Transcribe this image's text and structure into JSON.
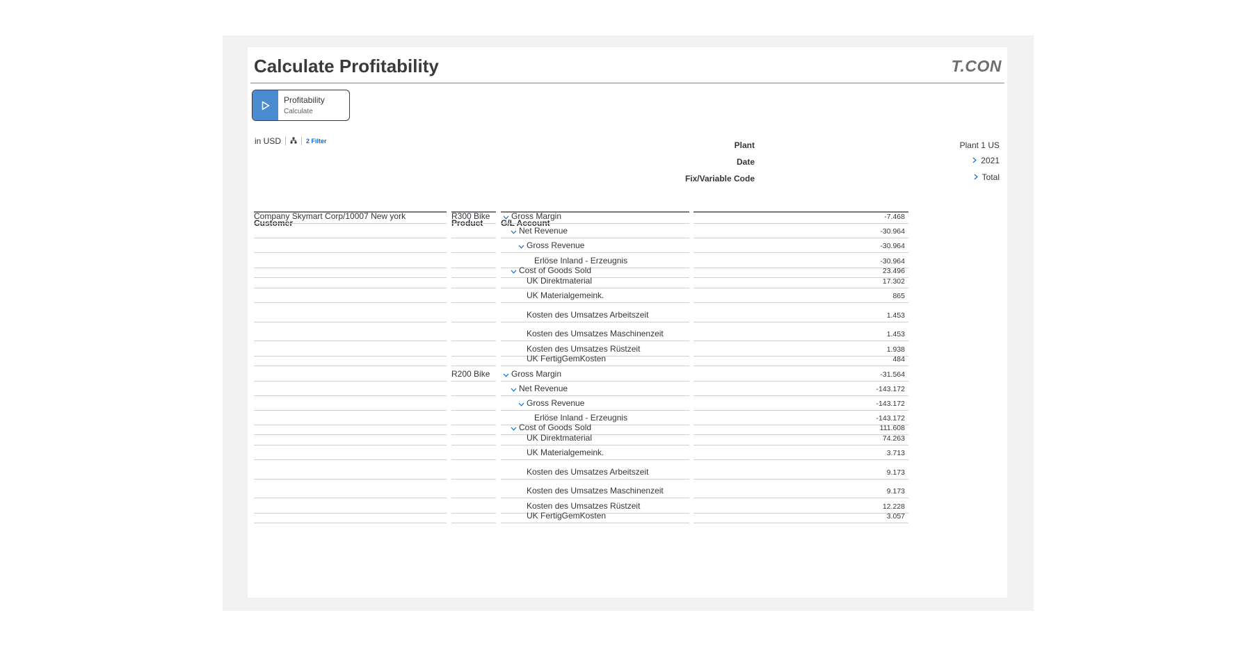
{
  "header": {
    "title": "Calculate Profitability",
    "logo_text": "T.CON"
  },
  "tile": {
    "title": "Profitability",
    "subtitle": "Calculate",
    "icon": "play-icon",
    "icon_bg": "#4a8ccf"
  },
  "subheader": {
    "currency": "in USD",
    "filter_icon": "hierarchy-icon",
    "filter_label": "2 Filter"
  },
  "dimensions": {
    "plant": {
      "label": "Plant",
      "value": "Plant 1 US"
    },
    "date": {
      "label": "Date",
      "value": "2021"
    },
    "fixvar": {
      "label": "Fix/Variable Code",
      "value": "Total"
    }
  },
  "columns": {
    "customer": "Customer",
    "product": "Product",
    "account": "G/L Account"
  },
  "rows": [
    {
      "customer": "Company Skymart Corp/10007 New york",
      "product": "R300 Bike",
      "account": "Gross Margin",
      "level": 0,
      "expanded": true,
      "value": "-7.468"
    },
    {
      "customer": "",
      "product": "",
      "account": "Net Revenue",
      "level": 1,
      "expanded": true,
      "value": "-30.964"
    },
    {
      "customer": "",
      "product": "",
      "account": "Gross Revenue",
      "level": 2,
      "expanded": true,
      "value": "-30.964"
    },
    {
      "customer": "",
      "product": "",
      "account": "Erlöse Inland - Erzeugnis",
      "level": 3,
      "expanded": false,
      "value": "-30.964"
    },
    {
      "customer": "",
      "product": "",
      "account": "Cost of Goods Sold",
      "level": 1,
      "expanded": true,
      "value": "23.496"
    },
    {
      "customer": "",
      "product": "",
      "account": "UK Direktmaterial",
      "level": 2,
      "expanded": false,
      "value": "17.302"
    },
    {
      "customer": "",
      "product": "",
      "account": "UK Materialgemeink.",
      "level": 2,
      "expanded": false,
      "value": "865"
    },
    {
      "customer": "",
      "product": "",
      "account": "Kosten des Umsatzes Arbeitszeit",
      "level": 2,
      "expanded": false,
      "value": "1.453"
    },
    {
      "customer": "",
      "product": "",
      "account": "Kosten des Umsatzes Maschinenzeit",
      "level": 2,
      "expanded": false,
      "value": "1.453"
    },
    {
      "customer": "",
      "product": "",
      "account": "Kosten des Umsatzes Rüstzeit",
      "level": 2,
      "expanded": false,
      "value": "1.938"
    },
    {
      "customer": "",
      "product": "",
      "account": "UK FertigGemKosten",
      "level": 2,
      "expanded": false,
      "value": "484"
    },
    {
      "customer": "",
      "product": "R200 Bike",
      "account": "Gross Margin",
      "level": 0,
      "expanded": true,
      "value": "-31.564"
    },
    {
      "customer": "",
      "product": "",
      "account": "Net Revenue",
      "level": 1,
      "expanded": true,
      "value": "-143.172"
    },
    {
      "customer": "",
      "product": "",
      "account": "Gross Revenue",
      "level": 2,
      "expanded": true,
      "value": "-143.172"
    },
    {
      "customer": "",
      "product": "",
      "account": "Erlöse Inland - Erzeugnis",
      "level": 3,
      "expanded": false,
      "value": "-143.172"
    },
    {
      "customer": "",
      "product": "",
      "account": "Cost of Goods Sold",
      "level": 1,
      "expanded": true,
      "value": "111.608"
    },
    {
      "customer": "",
      "product": "",
      "account": "UK Direktmaterial",
      "level": 2,
      "expanded": false,
      "value": "74.263"
    },
    {
      "customer": "",
      "product": "",
      "account": "UK Materialgemeink.",
      "level": 2,
      "expanded": false,
      "value": "3.713"
    },
    {
      "customer": "",
      "product": "",
      "account": "Kosten des Umsatzes Arbeitszeit",
      "level": 2,
      "expanded": false,
      "value": "9.173"
    },
    {
      "customer": "",
      "product": "",
      "account": "Kosten des Umsatzes Maschinenzeit",
      "level": 2,
      "expanded": false,
      "value": "9.173"
    },
    {
      "customer": "",
      "product": "",
      "account": "Kosten des Umsatzes Rüstzeit",
      "level": 2,
      "expanded": false,
      "value": "12.228"
    },
    {
      "customer": "",
      "product": "",
      "account": "UK FertigGemKosten",
      "level": 2,
      "expanded": false,
      "value": "3.057"
    }
  ]
}
